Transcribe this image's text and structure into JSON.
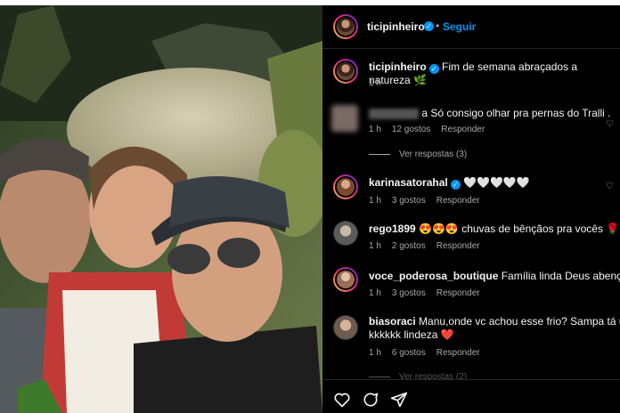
{
  "post": {
    "username": "ticipinheiro",
    "follow_label": "Seguir",
    "caption": "Fim de semana abraçados a natureza 🌿",
    "caption_time": "1 h"
  },
  "comments": [
    {
      "username": "",
      "text": "a Só consigo olhar pra pernas do Tralli .",
      "time": "1 h",
      "likes": "12 gostos",
      "reply": "Responder",
      "view_replies": "Ver respostas (3)"
    },
    {
      "username": "karinasatorahal",
      "verified": true,
      "text": "🤍🤍🤍🤍🤍",
      "time": "1 h",
      "likes": "3 gostos",
      "reply": "Responder"
    },
    {
      "username": "rego1899",
      "text": "😍😍😍 chuvas de bênçãos pra vocês 🌹🌹🌹",
      "time": "1 h",
      "likes": "2 gostos",
      "reply": "Responder"
    },
    {
      "username": "voce_poderosa_boutique",
      "text": "Família linda Deus abençoe 👏",
      "time": "1 h",
      "likes": "3 gostos",
      "reply": "Responder"
    },
    {
      "username": "biasoraci",
      "text": "Manu,onde vc achou esse frio? Sampa tá um fo",
      "text2": "kkkkkk lindeza ❤️",
      "time": "1 h",
      "likes": "6 gostos",
      "reply": "Responder",
      "view_replies": "Ver respostas (2)"
    }
  ],
  "icons": [
    "heart-icon",
    "comment-icon",
    "share-icon"
  ],
  "colors": {
    "link": "#0095f6",
    "background": "#000000",
    "muted": "#a8a8a8"
  }
}
